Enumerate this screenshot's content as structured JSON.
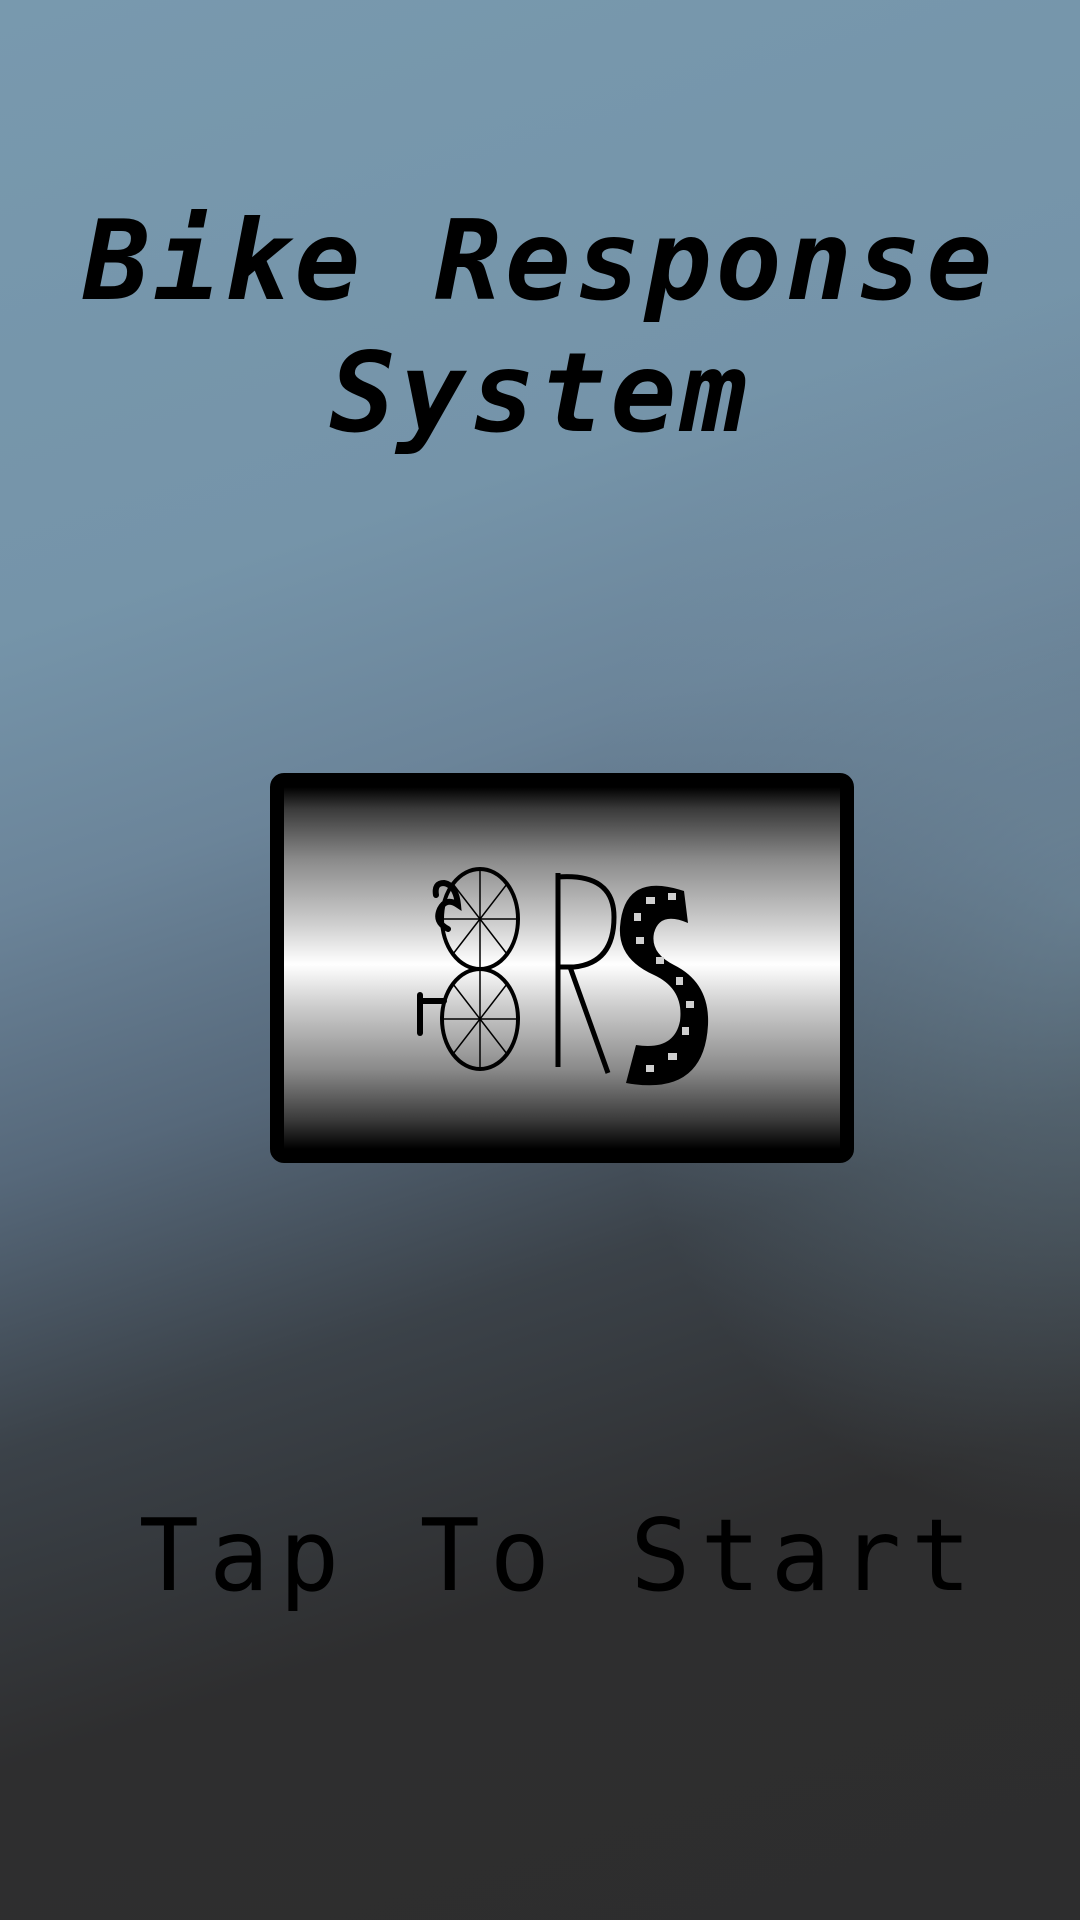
{
  "title": {
    "line1": "Bike Response",
    "line2": "System"
  },
  "logo": {
    "text": "BRS",
    "icon": "bike-response-system-logo"
  },
  "start": {
    "label": "Tap To Start"
  },
  "colors": {
    "background_top": "#7899ae",
    "background_bottom": "#2d2d2e",
    "text": "#000000",
    "logo_frame": "#000000"
  }
}
